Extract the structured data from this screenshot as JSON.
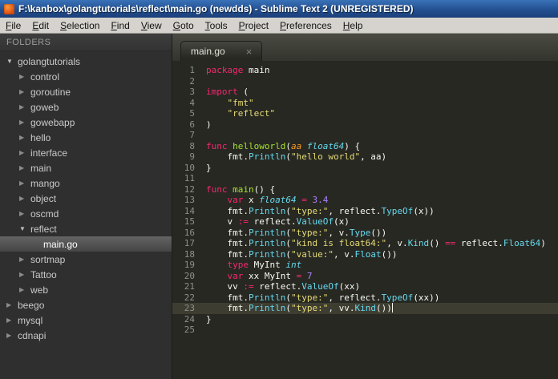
{
  "window": {
    "title": "F:\\kanbox\\golangtutorials\\reflect\\main.go (newdds) - Sublime Text 2 (UNREGISTERED)"
  },
  "menubar": {
    "items": [
      "File",
      "Edit",
      "Selection",
      "Find",
      "View",
      "Goto",
      "Tools",
      "Project",
      "Preferences",
      "Help"
    ]
  },
  "icons": {
    "folder_collapsed": "▶",
    "folder_expanded": "▼",
    "tab_close": "×"
  },
  "colors": {
    "editor_bg": "#272822",
    "current_line_bg": "#3e3d32",
    "keyword": "#f92672",
    "function_decl": "#a6e22e",
    "support_function": "#66d9ef",
    "type_italic": "#66d9ef",
    "string": "#e6db74",
    "number": "#ae81ff",
    "parameter": "#fd971f",
    "plain": "#f8f8f2",
    "line_number": "#8f908a",
    "titlebar_blue": "#235091"
  },
  "sidebar": {
    "header": "FOLDERS",
    "tree": [
      {
        "label": "golangtutorials",
        "level": 0,
        "kind": "folder",
        "state": "expanded"
      },
      {
        "label": "control",
        "level": 1,
        "kind": "folder",
        "state": "collapsed"
      },
      {
        "label": "goroutine",
        "level": 1,
        "kind": "folder",
        "state": "collapsed"
      },
      {
        "label": "goweb",
        "level": 1,
        "kind": "folder",
        "state": "collapsed"
      },
      {
        "label": "gowebapp",
        "level": 1,
        "kind": "folder",
        "state": "collapsed"
      },
      {
        "label": "hello",
        "level": 1,
        "kind": "folder",
        "state": "collapsed"
      },
      {
        "label": "interface",
        "level": 1,
        "kind": "folder",
        "state": "collapsed"
      },
      {
        "label": "main",
        "level": 1,
        "kind": "folder",
        "state": "collapsed"
      },
      {
        "label": "mango",
        "level": 1,
        "kind": "folder",
        "state": "collapsed"
      },
      {
        "label": "object",
        "level": 1,
        "kind": "folder",
        "state": "collapsed"
      },
      {
        "label": "oscmd",
        "level": 1,
        "kind": "folder",
        "state": "collapsed"
      },
      {
        "label": "reflect",
        "level": 1,
        "kind": "folder",
        "state": "expanded"
      },
      {
        "label": "main.go",
        "level": 2,
        "kind": "file",
        "selected": true
      },
      {
        "label": "sortmap",
        "level": 1,
        "kind": "folder",
        "state": "collapsed"
      },
      {
        "label": "Tattoo",
        "level": 1,
        "kind": "folder",
        "state": "collapsed"
      },
      {
        "label": "web",
        "level": 1,
        "kind": "folder",
        "state": "collapsed"
      },
      {
        "label": "beego",
        "level": 0,
        "kind": "folder",
        "state": "collapsed"
      },
      {
        "label": "mysql",
        "level": 0,
        "kind": "folder",
        "state": "collapsed"
      },
      {
        "label": "cdnapi",
        "level": 0,
        "kind": "folder",
        "state": "collapsed"
      }
    ]
  },
  "tabs": [
    {
      "label": "main.go",
      "active": true
    }
  ],
  "editor": {
    "current_line": 23,
    "lines": [
      {
        "n": 1,
        "tokens": [
          [
            "k",
            "package"
          ],
          [
            "p",
            " main"
          ]
        ]
      },
      {
        "n": 2,
        "tokens": []
      },
      {
        "n": 3,
        "tokens": [
          [
            "k",
            "import"
          ],
          [
            "p",
            " ("
          ]
        ]
      },
      {
        "n": 4,
        "tokens": [
          [
            "p",
            "    "
          ],
          [
            "str",
            "\"fmt\""
          ]
        ]
      },
      {
        "n": 5,
        "tokens": [
          [
            "p",
            "    "
          ],
          [
            "str",
            "\"reflect\""
          ]
        ]
      },
      {
        "n": 6,
        "tokens": [
          [
            "p",
            ")"
          ]
        ]
      },
      {
        "n": 7,
        "tokens": []
      },
      {
        "n": 8,
        "tokens": [
          [
            "k",
            "func"
          ],
          [
            "p",
            " "
          ],
          [
            "f",
            "helloworld"
          ],
          [
            "p",
            "("
          ],
          [
            "prm",
            "aa"
          ],
          [
            "p",
            " "
          ],
          [
            "t",
            "float64"
          ],
          [
            "p",
            ") {"
          ]
        ]
      },
      {
        "n": 9,
        "tokens": [
          [
            "p",
            "    fmt."
          ],
          [
            "s",
            "Println"
          ],
          [
            "p",
            "("
          ],
          [
            "str",
            "\"hello world\""
          ],
          [
            "p",
            ", aa)"
          ]
        ]
      },
      {
        "n": 10,
        "tokens": [
          [
            "p",
            "}"
          ]
        ]
      },
      {
        "n": 11,
        "tokens": []
      },
      {
        "n": 12,
        "tokens": [
          [
            "k",
            "func"
          ],
          [
            "p",
            " "
          ],
          [
            "f",
            "main"
          ],
          [
            "p",
            "() {"
          ]
        ]
      },
      {
        "n": 13,
        "tokens": [
          [
            "p",
            "    "
          ],
          [
            "k",
            "var"
          ],
          [
            "p",
            " x "
          ],
          [
            "t",
            "float64"
          ],
          [
            "p",
            " "
          ],
          [
            "o",
            "="
          ],
          [
            "p",
            " "
          ],
          [
            "num",
            "3.4"
          ]
        ]
      },
      {
        "n": 14,
        "tokens": [
          [
            "p",
            "    fmt."
          ],
          [
            "s",
            "Println"
          ],
          [
            "p",
            "("
          ],
          [
            "str",
            "\"type:\""
          ],
          [
            "p",
            ", reflect."
          ],
          [
            "s",
            "TypeOf"
          ],
          [
            "p",
            "(x))"
          ]
        ]
      },
      {
        "n": 15,
        "tokens": [
          [
            "p",
            "    v "
          ],
          [
            "o",
            ":="
          ],
          [
            "p",
            " reflect."
          ],
          [
            "s",
            "ValueOf"
          ],
          [
            "p",
            "(x)"
          ]
        ]
      },
      {
        "n": 16,
        "tokens": [
          [
            "p",
            "    fmt."
          ],
          [
            "s",
            "Println"
          ],
          [
            "p",
            "("
          ],
          [
            "str",
            "\"type:\""
          ],
          [
            "p",
            ", v."
          ],
          [
            "s",
            "Type"
          ],
          [
            "p",
            "())"
          ]
        ]
      },
      {
        "n": 17,
        "tokens": [
          [
            "p",
            "    fmt."
          ],
          [
            "s",
            "Println"
          ],
          [
            "p",
            "("
          ],
          [
            "str",
            "\"kind is float64:\""
          ],
          [
            "p",
            ", v."
          ],
          [
            "s",
            "Kind"
          ],
          [
            "p",
            "() "
          ],
          [
            "o",
            "=="
          ],
          [
            "p",
            " reflect."
          ],
          [
            "s",
            "Float64"
          ],
          [
            "p",
            ")"
          ]
        ]
      },
      {
        "n": 18,
        "tokens": [
          [
            "p",
            "    fmt."
          ],
          [
            "s",
            "Println"
          ],
          [
            "p",
            "("
          ],
          [
            "str",
            "\"value:\""
          ],
          [
            "p",
            ", v."
          ],
          [
            "s",
            "Float"
          ],
          [
            "p",
            "())"
          ]
        ]
      },
      {
        "n": 19,
        "tokens": [
          [
            "p",
            "    "
          ],
          [
            "k",
            "type"
          ],
          [
            "p",
            " MyInt "
          ],
          [
            "t",
            "int"
          ]
        ]
      },
      {
        "n": 20,
        "tokens": [
          [
            "p",
            "    "
          ],
          [
            "k",
            "var"
          ],
          [
            "p",
            " xx MyInt "
          ],
          [
            "o",
            "="
          ],
          [
            "p",
            " "
          ],
          [
            "num",
            "7"
          ]
        ]
      },
      {
        "n": 21,
        "tokens": [
          [
            "p",
            "    vv "
          ],
          [
            "o",
            ":="
          ],
          [
            "p",
            " reflect."
          ],
          [
            "s",
            "ValueOf"
          ],
          [
            "p",
            "(xx)"
          ]
        ]
      },
      {
        "n": 22,
        "tokens": [
          [
            "p",
            "    fmt."
          ],
          [
            "s",
            "Println"
          ],
          [
            "p",
            "("
          ],
          [
            "str",
            "\"type:\""
          ],
          [
            "p",
            ", reflect."
          ],
          [
            "s",
            "TypeOf"
          ],
          [
            "p",
            "(xx))"
          ]
        ]
      },
      {
        "n": 23,
        "tokens": [
          [
            "p",
            "    fmt."
          ],
          [
            "s",
            "Println"
          ],
          [
            "p",
            "("
          ],
          [
            "str",
            "\"type:\""
          ],
          [
            "p",
            ", vv."
          ],
          [
            "s",
            "Kind"
          ],
          [
            "p",
            "())"
          ]
        ]
      },
      {
        "n": 24,
        "tokens": [
          [
            "p",
            "}"
          ]
        ]
      },
      {
        "n": 25,
        "tokens": []
      }
    ]
  }
}
